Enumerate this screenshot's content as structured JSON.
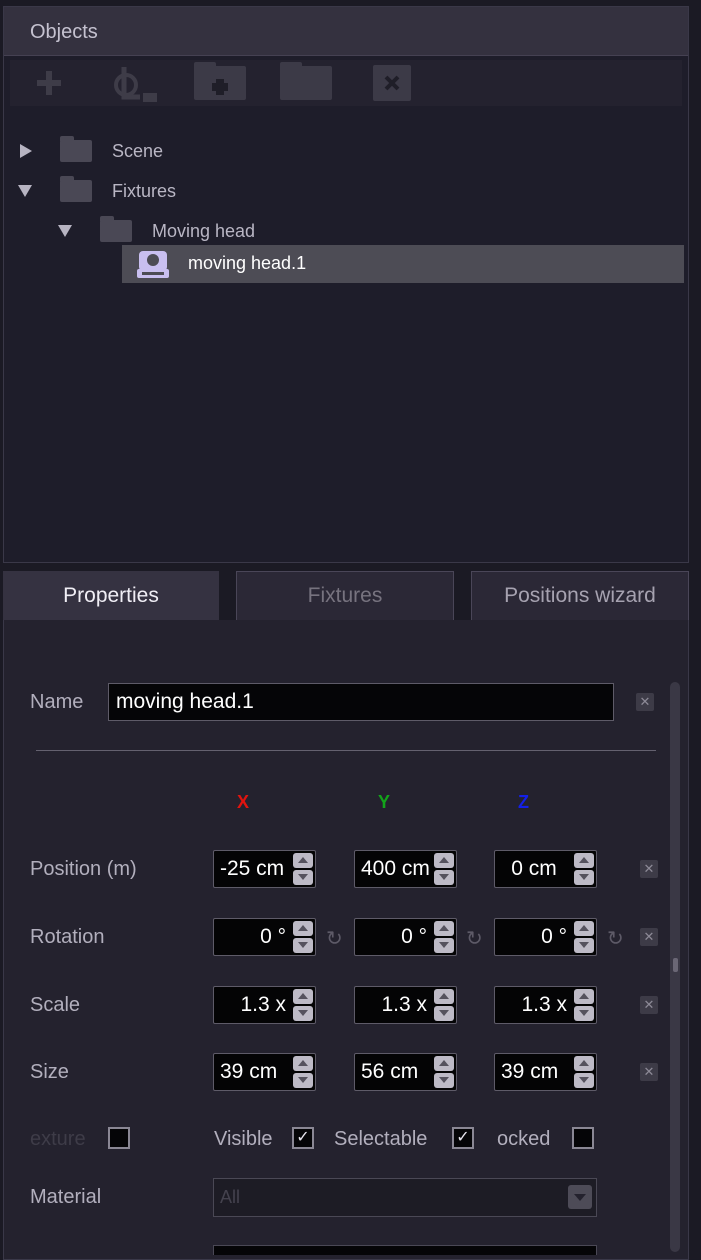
{
  "objects": {
    "title": "Objects",
    "toolbar": [
      "add-icon",
      "fixture-add-icon",
      "folder-add-icon",
      "folder-icon",
      "delete-icon"
    ],
    "tree": [
      {
        "label": "Scene",
        "expanded": false
      },
      {
        "label": "Fixtures",
        "expanded": true
      },
      {
        "label": "Moving head",
        "expanded": true
      },
      {
        "label": "moving head.1",
        "selected": true
      }
    ]
  },
  "tabs": {
    "properties": "Properties",
    "fixtures": "Fixtures",
    "positions": "Positions wizard"
  },
  "properties": {
    "name_label": "Name",
    "name_value": "moving head.1",
    "axes": {
      "x": "X",
      "y": "Y",
      "z": "Z"
    },
    "axis_colors": {
      "x": "#e0140f",
      "y": "#13a51a",
      "z": "#1420e8"
    },
    "position": {
      "label": "Position (m)",
      "x": "-25 cm",
      "y": "400 cm",
      "z": "0 cm"
    },
    "rotation": {
      "label": "Rotation",
      "x": "0 °",
      "y": "0 °",
      "z": "0 °"
    },
    "scale": {
      "label": "Scale",
      "x": "1.3 x",
      "y": "1.3 x",
      "z": "1.3 x"
    },
    "size": {
      "label": "Size",
      "x": "39 cm",
      "y": "56 cm",
      "z": "39 cm"
    },
    "checkboxes": {
      "texture": {
        "label": "exture",
        "checked": false
      },
      "visible": {
        "label": "Visible",
        "checked": true
      },
      "selectable": {
        "label": "Selectable",
        "checked": true
      },
      "locked": {
        "label": "ocked",
        "checked": false
      }
    },
    "material_label": "Material",
    "material_value": "All"
  },
  "glyphs": {
    "close": "✕",
    "check": "✓",
    "rotate": "↻"
  }
}
